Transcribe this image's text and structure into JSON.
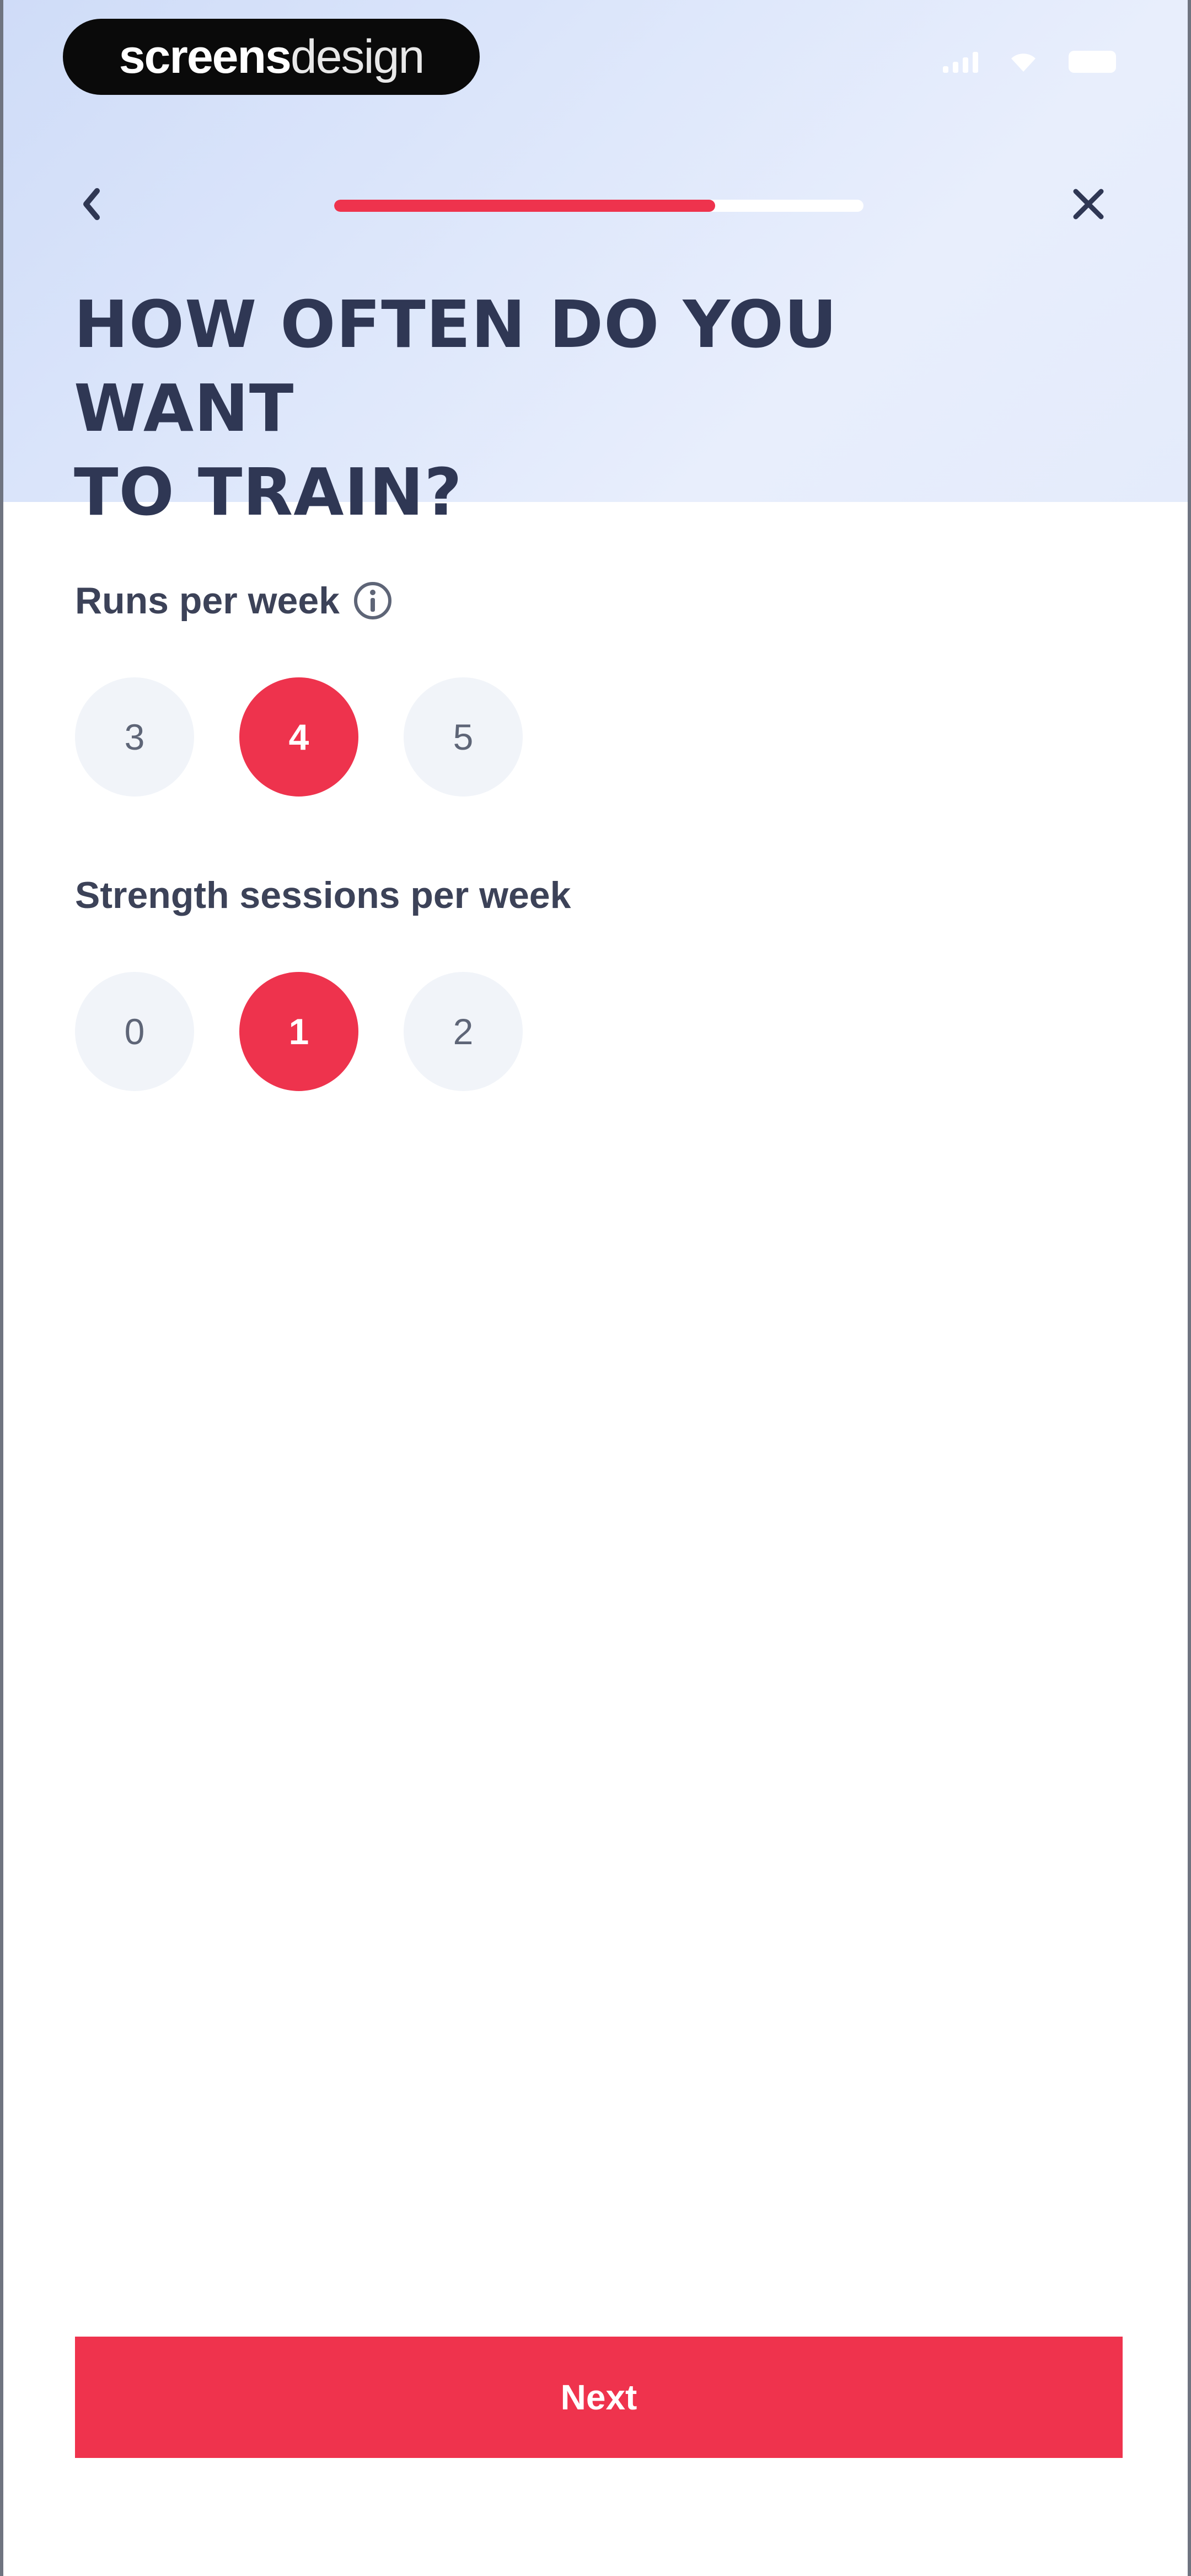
{
  "watermark": {
    "bold": "screens",
    "light": "design"
  },
  "header": {
    "progress": 0.72,
    "title": "HOW OFTEN DO YOU WANT\nTO TRAIN?"
  },
  "colors": {
    "accent": "#ee334d",
    "title": "#2f3754",
    "unselected": "#f1f4f9"
  },
  "icons": {
    "back": "chevron-left-icon",
    "close": "close-icon",
    "info": "info-icon"
  },
  "runs": {
    "label": "Runs per week",
    "options": [
      "3",
      "4",
      "5"
    ],
    "selected": "4"
  },
  "strength": {
    "label": "Strength sessions per week",
    "options": [
      "0",
      "1",
      "2"
    ],
    "selected": "1"
  },
  "footer": {
    "next_label": "Next"
  }
}
